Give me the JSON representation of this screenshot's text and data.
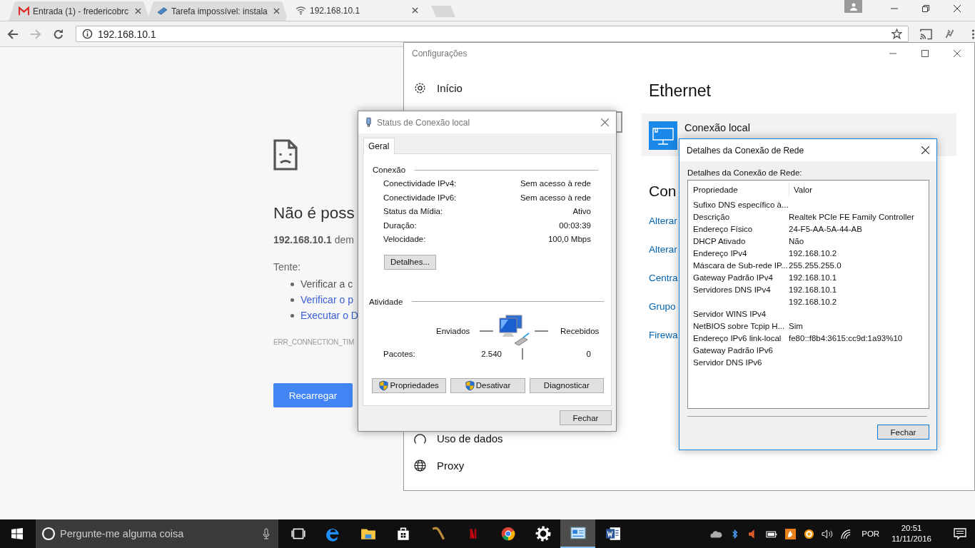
{
  "browser": {
    "tabs": [
      {
        "kind": "mail",
        "title": "Entrada (1) - fredericobrc",
        "selected": false
      },
      {
        "kind": "chip",
        "title": "Tarefa impossível: instala",
        "selected": false
      },
      {
        "kind": "wifi",
        "title": "192.168.10.1",
        "selected": true
      }
    ],
    "address": "192.168.10.1"
  },
  "error_page": {
    "title": "Não é poss",
    "message": "**192.168.10.1** dem",
    "try_label": "Tente:",
    "suggestions": [
      {
        "text": "Verificar a c",
        "link": false
      },
      {
        "text": "Verificar o p",
        "link": true
      },
      {
        "text": "Executar o D",
        "link": true
      }
    ],
    "code": "ERR_CONNECTION_TIM",
    "button": "Recarregar"
  },
  "settings": {
    "title": "Configurações",
    "nav_top": [
      {
        "kind": "gear",
        "label": "Início"
      }
    ],
    "nav_bottom": [
      {
        "kind": "data",
        "label": "Uso de dados"
      },
      {
        "kind": "globe",
        "label": "Proxy"
      }
    ],
    "heading": "Ethernet",
    "connection": "Conexão local",
    "section": "Con",
    "links": [
      "Alterar",
      "Alterar",
      "Centra",
      "Grupo",
      "Firewa"
    ]
  },
  "status_dialog": {
    "title": "Status de Conexão local",
    "tabs": [
      {
        "label": "Geral",
        "selected": true
      }
    ],
    "connection_group": "Conexão",
    "rows": [
      {
        "label": "Conectividade IPv4:",
        "value": "Sem acesso à rede"
      },
      {
        "label": "Conectividade IPv6:",
        "value": "Sem acesso à rede"
      },
      {
        "label": "Status da Mídia:",
        "value": "Ativo"
      },
      {
        "label": "Duração:",
        "value": "00:03:39"
      },
      {
        "label": "Velocidade:",
        "value": "100,0 Mbps"
      }
    ],
    "details_button": "Detalhes...",
    "activity_group": "Atividade",
    "sent_label": "Enviados",
    "received_label": "Recebidos",
    "packets_label": "Pacotes:",
    "packets_sent": "2.540",
    "packets_received": "0",
    "buttons": [
      {
        "label": "Propriedades",
        "shield": true
      },
      {
        "label": "Desativar",
        "shield": true
      },
      {
        "label": "Diagnosticar",
        "shield": false
      }
    ],
    "close_button": "Fechar"
  },
  "details_dialog": {
    "title": "Detalhes da Conexão de Rede",
    "label": "Detalhes da Conexão de Rede:",
    "columns": [
      "Propriedade",
      "Valor"
    ],
    "rows": [
      {
        "property": "Sufixo DNS específico à..."
      },
      {
        "property": "Descrição",
        "value": "Realtek PCIe FE Family Controller"
      },
      {
        "property": "Endereço Físico",
        "value": "24-F5-AA-5A-44-AB"
      },
      {
        "property": "DHCP Ativado",
        "value": "Não"
      },
      {
        "property": "Endereço IPv4",
        "value": "192.168.10.2"
      },
      {
        "property": "Máscara de Sub-rede IP...",
        "value": "255.255.255.0"
      },
      {
        "property": "Gateway Padrão IPv4",
        "value": "192.168.10.1"
      },
      {
        "property": "Servidores DNS IPv4",
        "value": "192.168.10.1"
      },
      {
        "value": "192.168.10.2"
      },
      {
        "property": "Servidor WINS IPv4"
      },
      {
        "property": "NetBIOS sobre Tcpip H...",
        "value": "Sim"
      },
      {
        "property": "Endereço IPv6 link-local",
        "value": "fe80::f8b4:3615:cc9d:1a93%10"
      },
      {
        "property": "Gateway Padrão IPv6"
      },
      {
        "property": "Servidor DNS IPv6"
      }
    ],
    "close_button": "Fechar"
  },
  "taskbar": {
    "search_placeholder": "Pergunte-me alguma coisa",
    "apps": [
      {
        "kind": "taskview",
        "active": false
      },
      {
        "kind": "edge",
        "active": false
      },
      {
        "kind": "folder",
        "active": false
      },
      {
        "kind": "store",
        "active": false
      },
      {
        "kind": "worm",
        "active": false
      },
      {
        "kind": "netflix",
        "active": false
      },
      {
        "kind": "chrome",
        "active": false
      },
      {
        "kind": "gear",
        "active": false
      },
      {
        "kind": "network",
        "active": true
      },
      {
        "kind": "word",
        "active": false
      }
    ],
    "language": "POR",
    "time": "20:51",
    "date": "11/11/2016"
  }
}
